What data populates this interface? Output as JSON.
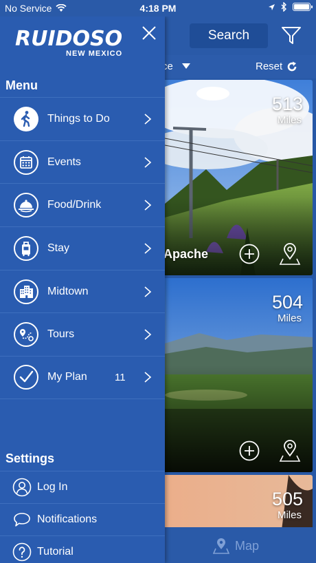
{
  "status_bar": {
    "carrier": "No Service",
    "time": "4:18 PM"
  },
  "header": {
    "search_label": "Search",
    "sort_label": "ce",
    "reset_label": "Reset"
  },
  "cards": [
    {
      "distance": "513",
      "unit": "Miles",
      "title": "Apache"
    },
    {
      "distance": "504",
      "unit": "Miles",
      "title": ""
    },
    {
      "distance": "505",
      "unit": "Miles",
      "title": ""
    }
  ],
  "bottom_bar": {
    "map_label": "Map"
  },
  "drawer": {
    "logo_main": "RUIDOSO",
    "logo_sub": "NEW MEXICO",
    "menu_heading": "Menu",
    "menu_items": [
      {
        "label": "Things to Do",
        "icon": "hiker-icon"
      },
      {
        "label": "Events",
        "icon": "calendar-icon"
      },
      {
        "label": "Food/Drink",
        "icon": "food-cloche-icon"
      },
      {
        "label": "Stay",
        "icon": "luggage-icon"
      },
      {
        "label": "Midtown",
        "icon": "building-icon"
      },
      {
        "label": "Tours",
        "icon": "map-route-icon"
      },
      {
        "label": "My Plan",
        "icon": "checkmark-icon",
        "count": "11"
      }
    ],
    "settings_heading": "Settings",
    "settings_items": [
      {
        "label": "Log In",
        "icon": "user-icon"
      },
      {
        "label": "Notifications",
        "icon": "speech-bubble-icon"
      },
      {
        "label": "Tutorial",
        "icon": "question-icon"
      }
    ]
  },
  "colors": {
    "drawer_bg": "#2a5cb0",
    "header_bg": "#2a5aa8",
    "divider": "#3e6fbe"
  }
}
